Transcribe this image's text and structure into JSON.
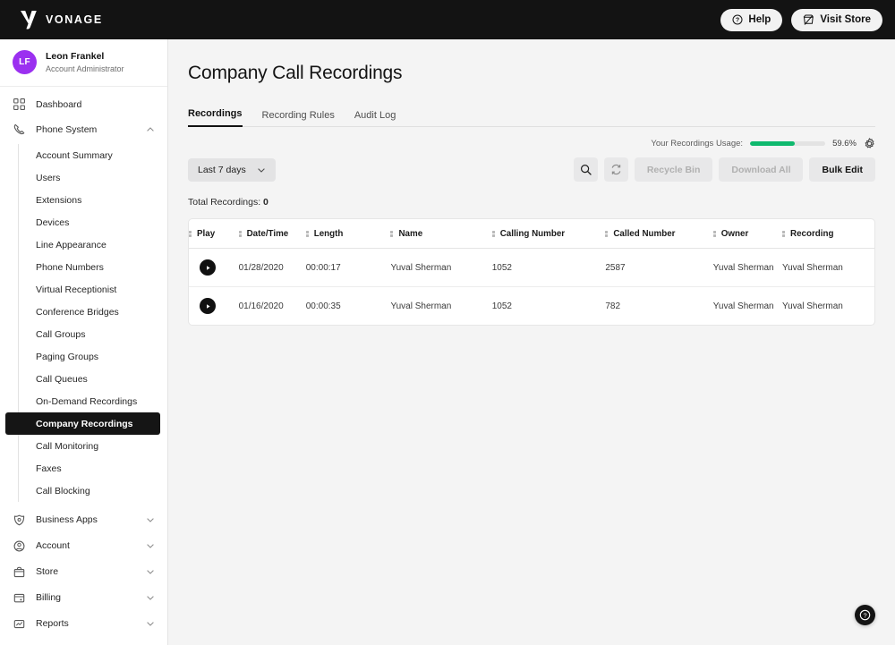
{
  "topbar": {
    "brand_name": "VONAGE",
    "brand_icon": "vonage-logo-icon",
    "help_label": "Help",
    "help_icon": "question-circle-icon",
    "visit_store_label": "Visit Store",
    "visit_store_icon": "store-icon"
  },
  "sidebar": {
    "user": {
      "initials": "LF",
      "name": "Leon Frankel",
      "role": "Account Administrator",
      "avatar_color": "#9b30f0"
    },
    "groups": [
      {
        "label": "Dashboard",
        "icon": "grid-squares-icon",
        "expandable": false
      },
      {
        "label": "Phone System",
        "icon": "phone-handset-icon",
        "expandable": true,
        "expanded": true,
        "chevron": "chevron-up-icon",
        "items": [
          {
            "label": "Account Summary",
            "active": false
          },
          {
            "label": "Users",
            "active": false
          },
          {
            "label": "Extensions",
            "active": false
          },
          {
            "label": "Devices",
            "active": false
          },
          {
            "label": "Line Appearance",
            "active": false
          },
          {
            "label": "Phone Numbers",
            "active": false
          },
          {
            "label": "Virtual Receptionist",
            "active": false
          },
          {
            "label": "Conference Bridges",
            "active": false
          },
          {
            "label": "Call Groups",
            "active": false
          },
          {
            "label": "Paging Groups",
            "active": false
          },
          {
            "label": "Call Queues",
            "active": false
          },
          {
            "label": "On-Demand Recordings",
            "active": false
          },
          {
            "label": "Company Recordings",
            "active": true
          },
          {
            "label": "Call Monitoring",
            "active": false
          },
          {
            "label": "Faxes",
            "active": false
          },
          {
            "label": "Call Blocking",
            "active": false
          }
        ]
      },
      {
        "label": "Business Apps",
        "icon": "shield-apps-icon",
        "expandable": true,
        "expanded": false,
        "chevron": "chevron-down-icon"
      },
      {
        "label": "Account",
        "icon": "user-circle-icon",
        "expandable": true,
        "expanded": false,
        "chevron": "chevron-down-icon"
      },
      {
        "label": "Store",
        "icon": "store-bag-icon",
        "expandable": true,
        "expanded": false,
        "chevron": "chevron-down-icon"
      },
      {
        "label": "Billing",
        "icon": "billing-card-icon",
        "expandable": true,
        "expanded": false,
        "chevron": "chevron-down-icon"
      },
      {
        "label": "Reports",
        "icon": "chart-report-icon",
        "expandable": true,
        "expanded": false,
        "chevron": "chevron-down-icon"
      }
    ]
  },
  "main": {
    "page_title": "Company Call Recordings",
    "tabs": [
      {
        "label": "Recordings",
        "active": true
      },
      {
        "label": "Recording Rules",
        "active": false
      },
      {
        "label": "Audit Log",
        "active": false
      }
    ],
    "usage": {
      "label": "Your Recordings Usage:",
      "percent_text": "59.6%",
      "percent_value": 59.6,
      "bar_color": "#0fb96e",
      "gear_icon": "gear-icon"
    },
    "toolbar": {
      "date_filter_value": "Last 7 days",
      "date_filter_chevron": "chevron-down-icon",
      "search_icon": "search-icon",
      "refresh_icon": "refresh-icon",
      "recycle_bin_label": "Recycle Bin",
      "recycle_bin_disabled": true,
      "download_all_label": "Download All",
      "download_all_disabled": true,
      "bulk_edit_label": "Bulk Edit",
      "bulk_edit_disabled": false
    },
    "total_recordings_label": "Total Recordings:",
    "total_recordings_value": "0",
    "table": {
      "columns": [
        "Play",
        "Date/Time",
        "Length",
        "Name",
        "Calling Number",
        "Called Number",
        "Owner",
        "Recording"
      ],
      "rows": [
        {
          "play_icon": "play-circle-icon",
          "date": "01/28/2020",
          "length": "00:00:17",
          "name": "Yuval Sherman",
          "calling_number": "1052",
          "called_number": "2587",
          "owner": "Yuval Sherman",
          "recording": "Yuval Sherman"
        },
        {
          "play_icon": "play-circle-icon",
          "date": "01/16/2020",
          "length": "00:00:35",
          "name": "Yuval Sherman",
          "calling_number": "1052",
          "called_number": "782",
          "owner": "Yuval Sherman",
          "recording": "Yuval Sherman"
        }
      ]
    },
    "help_fab_icon": "question-circle-icon"
  }
}
